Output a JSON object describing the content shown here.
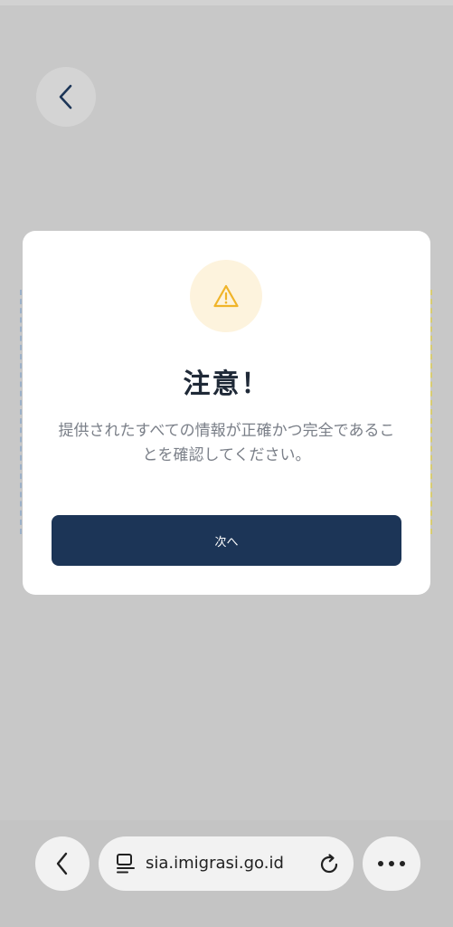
{
  "page": {
    "background": "#c8c8c8"
  },
  "modal": {
    "icon": "warning-triangle-icon",
    "title": "注意！",
    "message": "提供されたすべての情報が正確かつ完全であることを確認してください。",
    "next_label": "次へ",
    "button_color": "#1c3557",
    "icon_color": "#f0b429"
  },
  "browser": {
    "url": "sia.imigrasi.go.id",
    "back_icon": "chevron-left-icon",
    "tab_icon": "tabs-icon",
    "reload_icon": "reload-icon",
    "more_icon": "more-horizontal-icon"
  },
  "header": {
    "back_icon": "chevron-left-icon"
  }
}
